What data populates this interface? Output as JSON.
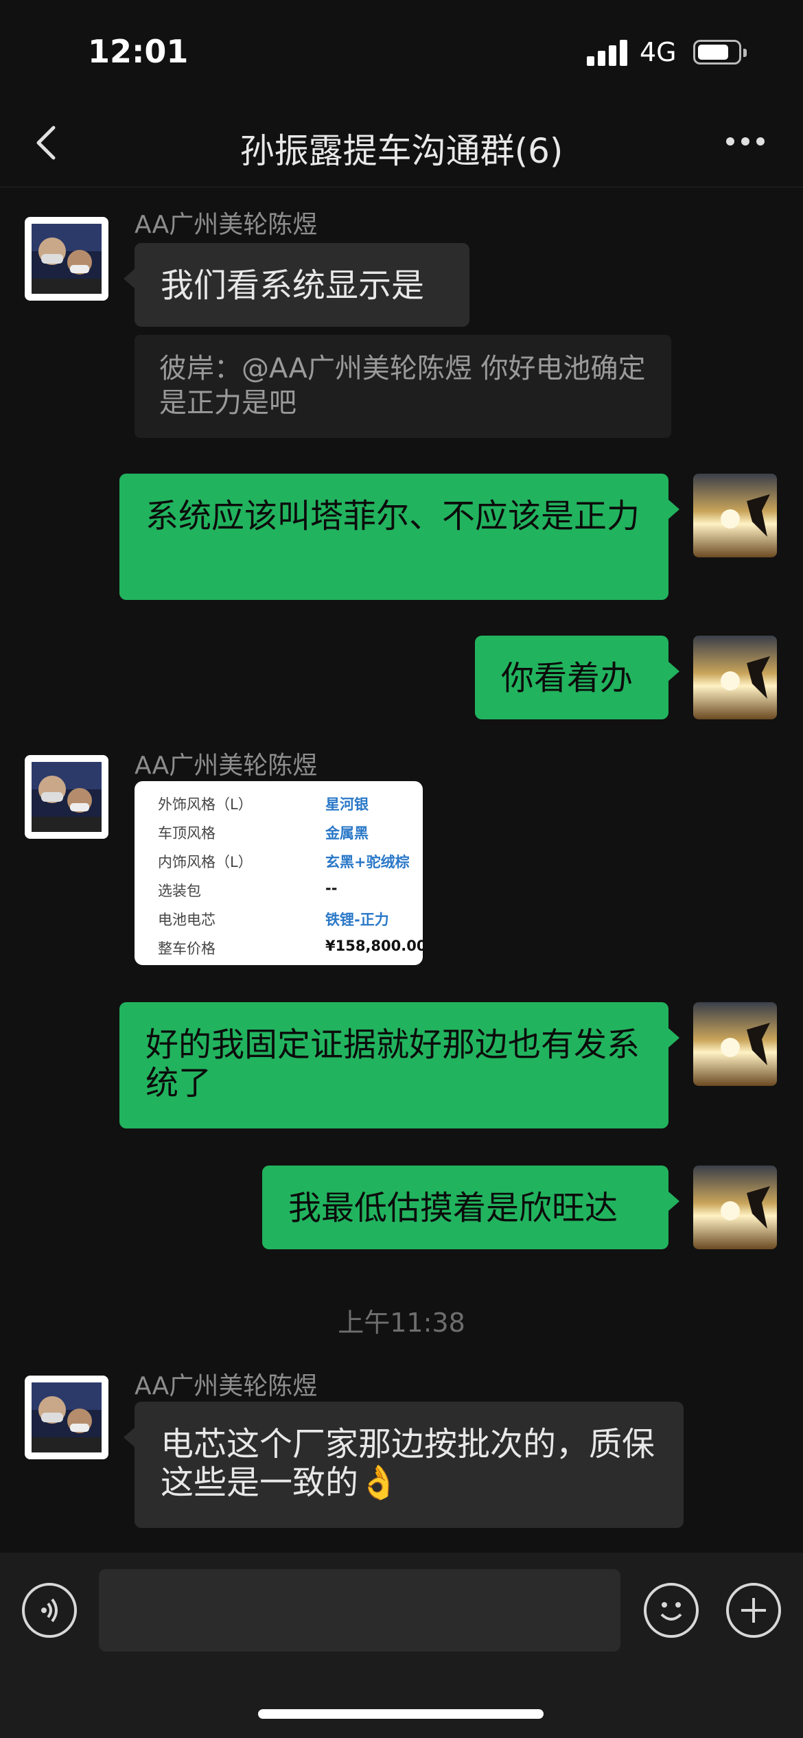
{
  "status_bar": {
    "time": "12:01",
    "network": "4G",
    "signal_icon": "signal-bars-icon",
    "battery_icon": "battery-icon"
  },
  "nav": {
    "back_icon": "chevron-left-icon",
    "title": "孙振露提车沟通群(6)",
    "more_icon": "more-dots-icon"
  },
  "messages": [
    {
      "type": "text",
      "side": "left",
      "sender": "AA广州美轮陈煜",
      "text": "我们看系统显示是",
      "quote": "彼岸：@AA广州美轮陈煜 你好电池确定是正力是吧"
    },
    {
      "type": "text",
      "side": "right",
      "text": "系统应该叫塔菲尔、不应该是正力"
    },
    {
      "type": "text",
      "side": "right",
      "text": "你看着办"
    },
    {
      "type": "image",
      "side": "left",
      "sender": "AA广州美轮陈煜",
      "rows": [
        {
          "label": "外饰风格（L）",
          "value": "星河银"
        },
        {
          "label": "车顶风格",
          "value": "金属黑"
        },
        {
          "label": "内饰风格（L）",
          "value": "玄黑+驼绒棕"
        },
        {
          "label": "选装包",
          "value": "--"
        },
        {
          "label": "电池电芯",
          "value": "铁锂-正力"
        },
        {
          "label": "整车价格",
          "value": "¥158,800.00"
        }
      ]
    },
    {
      "type": "text",
      "side": "right",
      "text": "好的我固定证据就好那边也有发系统了"
    },
    {
      "type": "text",
      "side": "right",
      "text": "我最低估摸着是欣旺达"
    },
    {
      "type": "timestamp",
      "text": "上午11:38"
    },
    {
      "type": "text",
      "side": "left",
      "sender": "AA广州美轮陈煜",
      "text": "电芯这个厂家那边按批次的，质保这些是一致的👌"
    }
  ],
  "input_bar": {
    "voice_icon": "voice-icon",
    "emoji_icon": "emoji-icon",
    "plus_icon": "plus-icon",
    "text": ""
  },
  "colors": {
    "background": "#111111",
    "bubble_out": "#22b35e",
    "bubble_in": "#2c2c2c",
    "link_blue": "#2a78c8"
  }
}
